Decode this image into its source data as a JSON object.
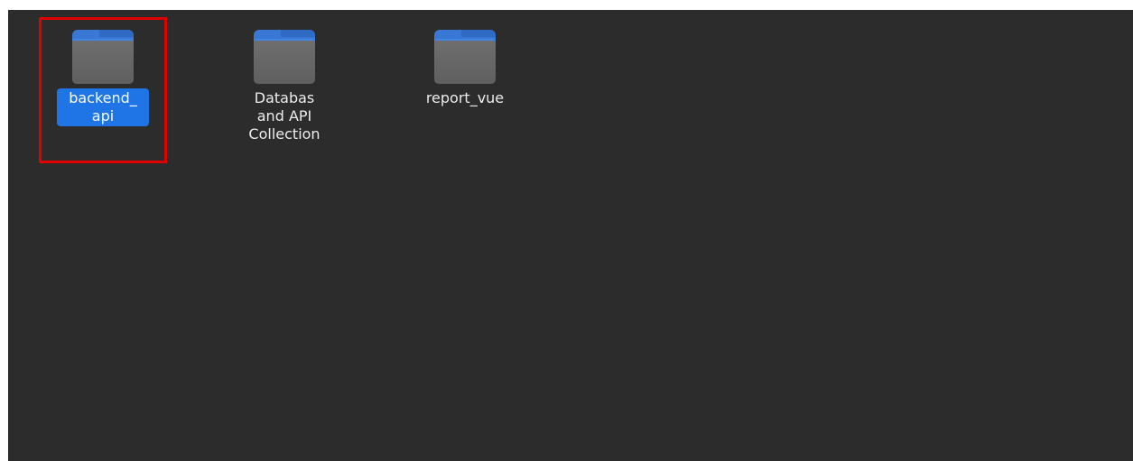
{
  "accent_color": "#1f74e6",
  "highlight_color": "#e00000",
  "folders": [
    {
      "label": "backend_ api",
      "selected": true,
      "icon": "folder-icon"
    },
    {
      "label": "Databas and API Collection",
      "selected": false,
      "icon": "folder-icon"
    },
    {
      "label": "report_vue",
      "selected": false,
      "icon": "folder-icon"
    }
  ]
}
